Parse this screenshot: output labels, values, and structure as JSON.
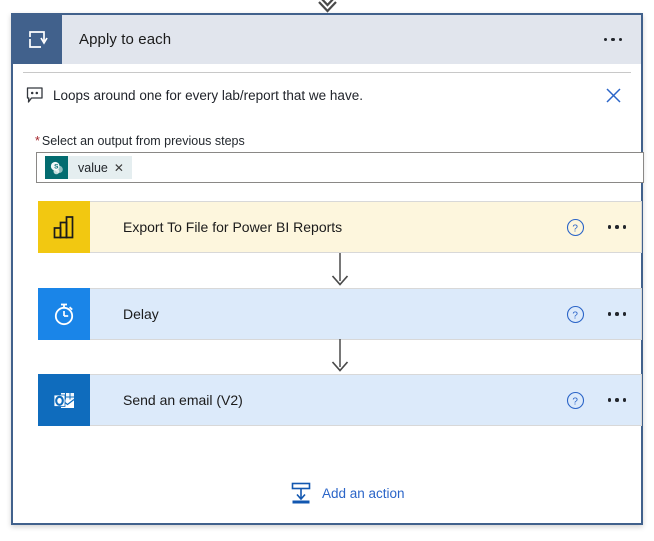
{
  "colors": {
    "loop_border": "#41618c",
    "header_bg": "#e1e5ed",
    "header_icon_bg": "#41618c",
    "accent_blue": "#2b65c8",
    "required_star": "#a4262c",
    "powerbi_yellow": "#f2c811",
    "delay_blue": "#1a85e8",
    "outlook_blue": "#0f6cbd",
    "sharepoint_teal": "#036c70",
    "card_powerbi_bg": "#fdf6dd",
    "card_blue_bg": "#dceafa"
  },
  "top_connector": {
    "icon": "arrow-down-icon"
  },
  "loop": {
    "icon": "loop-repeat-icon",
    "title": "Apply to each",
    "menu_icon": "ellipsis-icon"
  },
  "comment": {
    "icon": "comment-bubble-icon",
    "text": "Loops around one for every lab/report that we have.",
    "close_icon": "close-icon"
  },
  "field": {
    "required_marker": "*",
    "label": "Select an output from previous steps",
    "token": {
      "icon": "sharepoint-icon",
      "label": "value",
      "remove_icon": "close-icon",
      "remove_glyph": "✕"
    }
  },
  "actions": [
    {
      "icon": "powerbi-icon",
      "label": "Export To File for Power BI Reports",
      "help_icon": "help-circle-icon",
      "menu_icon": "ellipsis-icon",
      "icon_bg": "#f2c811",
      "card_bg": "#fdf6dd"
    },
    {
      "icon": "stopwatch-icon",
      "label": "Delay",
      "help_icon": "help-circle-icon",
      "menu_icon": "ellipsis-icon",
      "icon_bg": "#1a85e8",
      "card_bg": "#dceafa"
    },
    {
      "icon": "outlook-icon",
      "label": "Send an email (V2)",
      "help_icon": "help-circle-icon",
      "menu_icon": "ellipsis-icon",
      "icon_bg": "#0f6cbd",
      "card_bg": "#dceafa"
    }
  ],
  "connectors": [
    {
      "icon": "arrow-down-icon"
    },
    {
      "icon": "arrow-down-icon"
    }
  ],
  "add_action": {
    "icon": "insert-action-icon",
    "label": "Add an action"
  }
}
